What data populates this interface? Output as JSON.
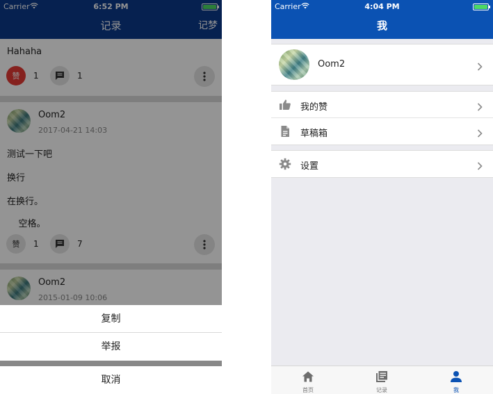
{
  "colors": {
    "left_navbar": "#0b3a8a",
    "right_navbar": "#0b52b3",
    "like_active": "#e53935",
    "tab_active": "#0b52b3"
  },
  "left_screen": {
    "status": {
      "carrier": "Carrier",
      "time": "6:52 PM"
    },
    "navbar": {
      "title": "记录",
      "right_action": "记梦"
    },
    "posts": [
      {
        "lines": [
          "Hahaha"
        ],
        "like_label": "赞",
        "like_count": "1",
        "comment_count": "1",
        "liked": true
      },
      {
        "author": "Oom2",
        "date": "2017-04-21 14:03",
        "lines": [
          "测试一下吧",
          "换行",
          "在换行。",
          "    空格。"
        ],
        "like_label": "赞",
        "like_count": "1",
        "comment_count": "7",
        "liked": false
      },
      {
        "author": "Oom2",
        "date": "2015-01-09 10:06"
      }
    ],
    "action_sheet": {
      "copy": "复制",
      "report": "举报",
      "cancel": "取消"
    }
  },
  "right_screen": {
    "status": {
      "carrier": "Carrier",
      "time": "4:04 PM"
    },
    "navbar": {
      "title": "我"
    },
    "profile": {
      "name": "Oom2"
    },
    "menu": {
      "my_likes": "我的赞",
      "drafts": "草稿箱",
      "settings": "设置"
    },
    "tabs": [
      {
        "label": "首页",
        "icon": "home-icon"
      },
      {
        "label": "记录",
        "icon": "records-icon"
      },
      {
        "label": "我",
        "icon": "person-icon"
      }
    ]
  }
}
